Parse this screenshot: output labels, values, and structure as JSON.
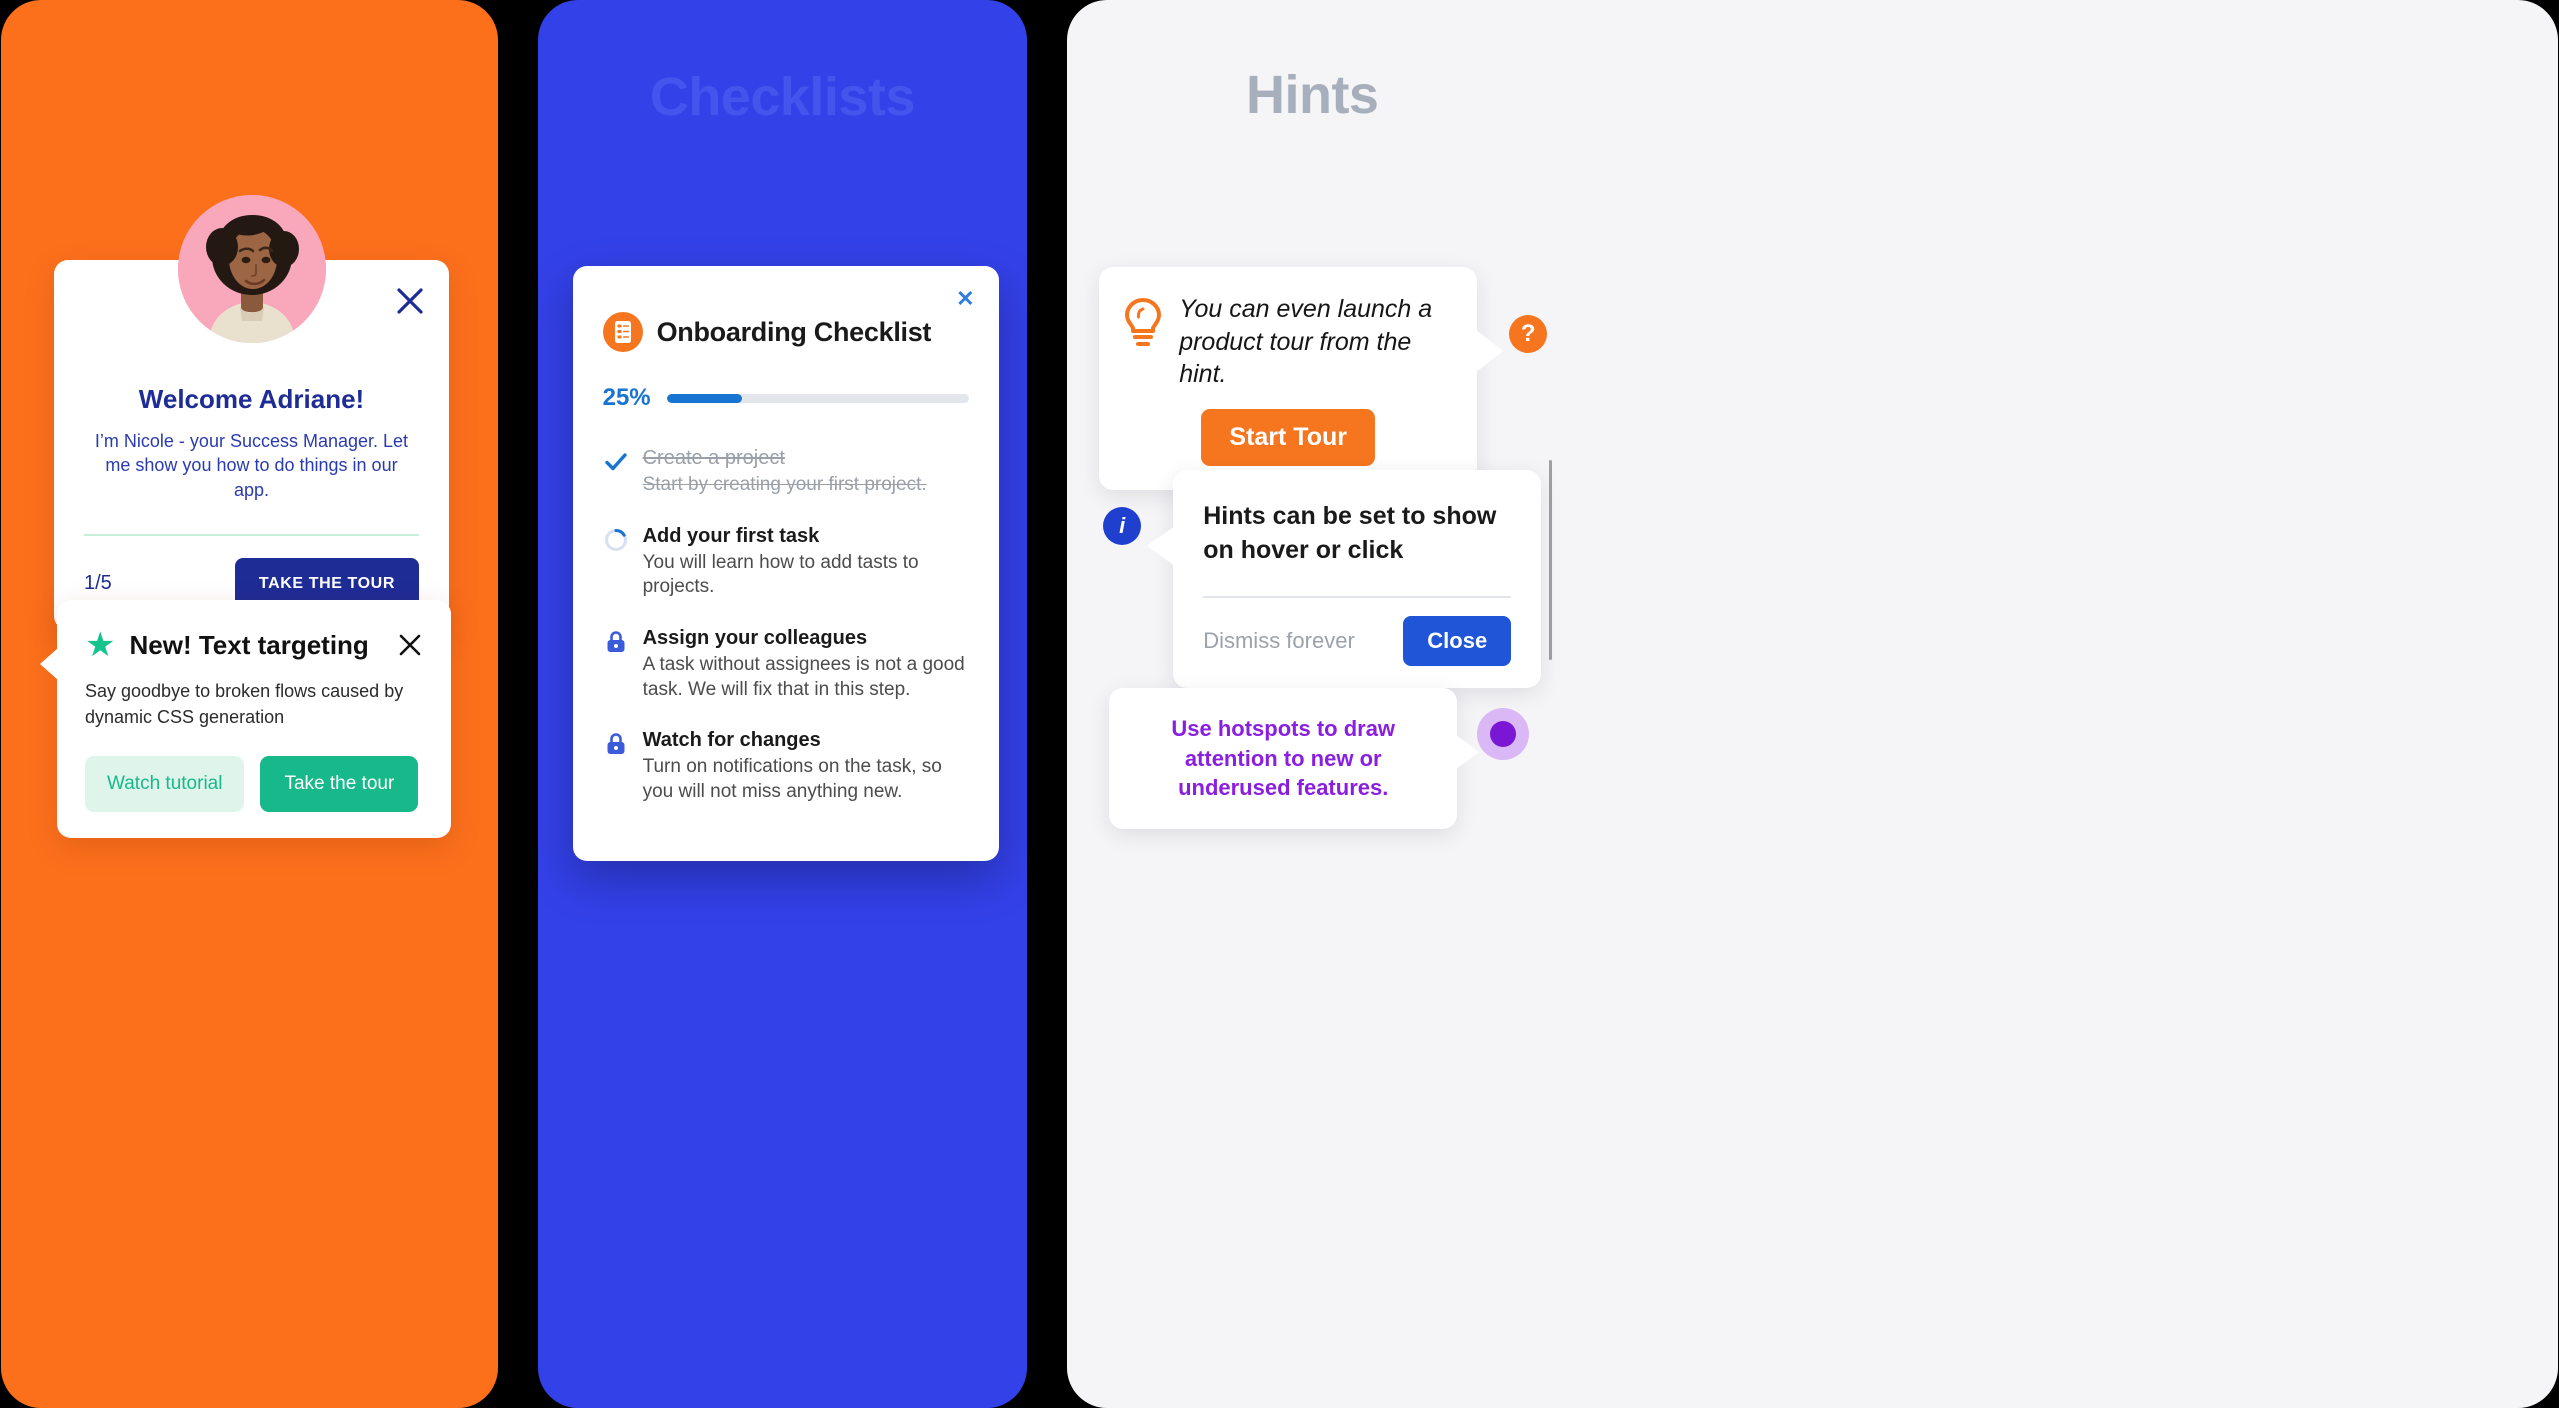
{
  "panels": {
    "tours": {
      "heading": "",
      "bg_color": "#FC701C"
    },
    "checklists": {
      "heading": "Checklists",
      "bg_color": "#3341E8"
    },
    "hints": {
      "heading": "Hints",
      "bg_color": "#F5F5F7"
    }
  },
  "welcome_card": {
    "title": "Welcome Adriane!",
    "subtitle": "I’m Nicole - your Success Manager. Let me show you how to do things in our app.",
    "step": "1/5",
    "cta_label": "TAKE THE TOUR",
    "close_icon": "close-icon",
    "avatar_icon": "avatar",
    "title_color": "#1E2C96",
    "cta_bg": "#1E2C96"
  },
  "feature_card": {
    "star_icon": "star-icon",
    "title": "New! Text targeting",
    "description": "Say goodbye to broken flows caused by dynamic CSS generation",
    "secondary_label": "Watch tutorial",
    "primary_label": "Take the tour",
    "close_icon": "close-icon",
    "accent_color": "#17B98A"
  },
  "checklist_card": {
    "title": "Onboarding Checklist",
    "icon": "checklist-icon",
    "close_icon": "close-icon",
    "progress_percent": "25%",
    "progress_value": 25,
    "progress_color": "#1775D1",
    "items": [
      {
        "state": "done",
        "icon": "check-icon",
        "title": "Create a project",
        "description": "Start by creating your first project."
      },
      {
        "state": "active",
        "icon": "spinner-icon",
        "title": "Add your first task",
        "description": "You will learn how to add tasts to projects."
      },
      {
        "state": "locked",
        "icon": "lock-icon",
        "title": "Assign your colleagues",
        "description": "A task without assignees is not a good task. We will fix that in this step."
      },
      {
        "state": "locked",
        "icon": "lock-icon",
        "title": "Watch for changes",
        "description": "Turn on notifications on the task, so you will not miss anything new."
      }
    ]
  },
  "hint_tour": {
    "icon": "lightbulb-icon",
    "text": "You can even launch a product tour from the hint.",
    "cta_label": "Start Tour",
    "badge_label": "?",
    "badge_icon": "question-mark-icon",
    "accent_color": "#F5761F"
  },
  "hint_hover": {
    "text": "Hints can be set to show on hover or click",
    "dismiss_label": "Dismiss forever",
    "close_label": "Close",
    "badge_label": "i",
    "badge_icon": "info-icon",
    "accent_color": "#1F55D6"
  },
  "hint_hotspot": {
    "text": "Use hotspots to draw attention to new or underused features.",
    "dot_icon": "hotspot-dot-icon",
    "accent_color": "#8A1FE0"
  }
}
